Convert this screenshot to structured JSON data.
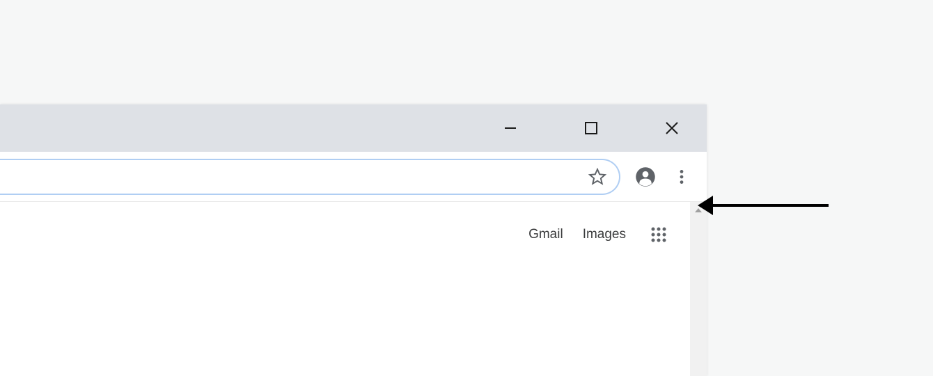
{
  "window_controls": {
    "minimize": "minimize",
    "maximize": "maximize",
    "close": "close"
  },
  "toolbar": {
    "bookmark": "bookmark",
    "profile": "profile",
    "menu": "menu"
  },
  "page": {
    "links": {
      "gmail": "Gmail",
      "images": "Images"
    },
    "apps": "apps"
  }
}
